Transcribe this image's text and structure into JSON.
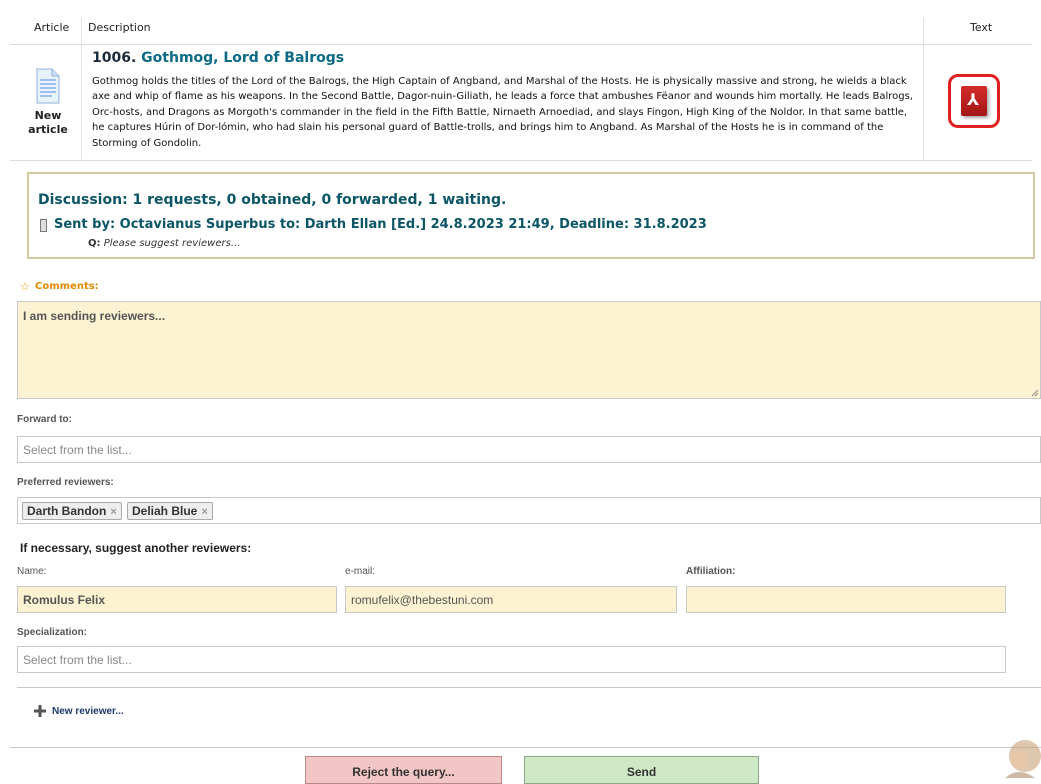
{
  "table": {
    "headers": {
      "article": "Article",
      "description": "Description",
      "text": "Text"
    },
    "row": {
      "badge": "New article",
      "number": "1006.",
      "title": "Gothmog, Lord of Balrogs",
      "description": "Gothmog holds the titles of the Lord of the Balrogs, the High Captain of Angband, and Marshal of the Hosts. He is physically massive and strong, he wields a black axe and whip of flame as his weapons. In the Second Battle, Dagor-nuin-Giliath, he leads a force that ambushes Fëanor and wounds him mortally. He leads Balrogs, Orc-hosts, and Dragons as Morgoth's commander in the field in the Fifth Battle, Nirnaeth Arnoediad, and slays Fingon, High King of the Noldor. In that same battle, he captures Húrin of Dor-lómin, who had slain his personal guard of Battle-trolls, and brings him to Angband. As Marshal of the Hosts he is in command of the Storming of Gondolin.",
      "text_icon": "pdf-icon"
    }
  },
  "discussion": {
    "title": "Discussion: 1 requests, 0 obtained, 0 forwarded, 1 waiting.",
    "sent": "Sent by: Octavianus Superbus to: Darth Ellan [Ed.] 24.8.2023 21:49, Deadline: 31.8.2023",
    "q_label": "Q:",
    "q_text": "Please suggest reviewers…"
  },
  "form": {
    "comments_label": "Comments:",
    "comments_value": "I am sending reviewers...",
    "forward_label": "Forward to:",
    "forward_placeholder": "Select from the list...",
    "preferred_label": "Preferred reviewers:",
    "preferred": [
      "Darth Bandon",
      "Deliah Blue"
    ],
    "suggest_heading": "If necessary, suggest another reviewers:",
    "name_label": "Name:",
    "name_value": "Romulus Felix",
    "email_label": "e-mail:",
    "email_value": "romufelix@thebestuni.com",
    "affiliation_label": "Affiliation:",
    "affiliation_value": "",
    "specialization_label": "Specialization:",
    "specialization_placeholder": "Select from the list...",
    "new_reviewer": "New reviewer..."
  },
  "buttons": {
    "reject": "Reject the query...",
    "send": "Send"
  },
  "remove_glyph": "×",
  "colors": {
    "accent": "#0b5566",
    "pdf_red": "#e02020",
    "field_fill": "#fdf3d2",
    "reject": "#f3c6c6",
    "send": "#cfe8c4"
  }
}
